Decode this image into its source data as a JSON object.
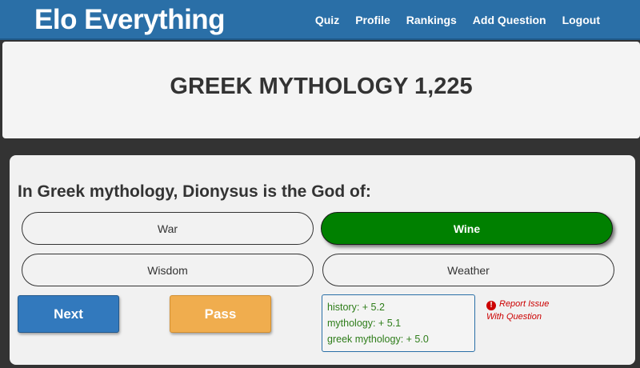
{
  "app": {
    "brand": "Elo Everything"
  },
  "nav": {
    "items": [
      "Quiz",
      "Profile",
      "Rankings",
      "Add Question",
      "Logout"
    ]
  },
  "topic": {
    "title": "GREEK MYTHOLOGY 1,225"
  },
  "quiz": {
    "question": "In Greek mythology, Dionysus is the God of:",
    "answers": [
      {
        "label": "War",
        "state": "default"
      },
      {
        "label": "Wine",
        "state": "correct"
      },
      {
        "label": "Wisdom",
        "state": "default"
      },
      {
        "label": "Weather",
        "state": "default"
      }
    ],
    "next_label": "Next",
    "pass_label": "Pass",
    "score_changes": [
      "history: + 5.2",
      "mythology: + 5.1",
      "greek mythology: + 5.0"
    ],
    "report_issue": {
      "icon": "exclamation-circle-icon",
      "line1": "Report Issue",
      "line2": "With Question"
    }
  },
  "colors": {
    "navbar": "#2a6fa7",
    "correct": "#008000",
    "next": "#3279bd",
    "pass": "#f0ad4e",
    "score_text": "#2e7d1a",
    "report": "#cc0000"
  }
}
